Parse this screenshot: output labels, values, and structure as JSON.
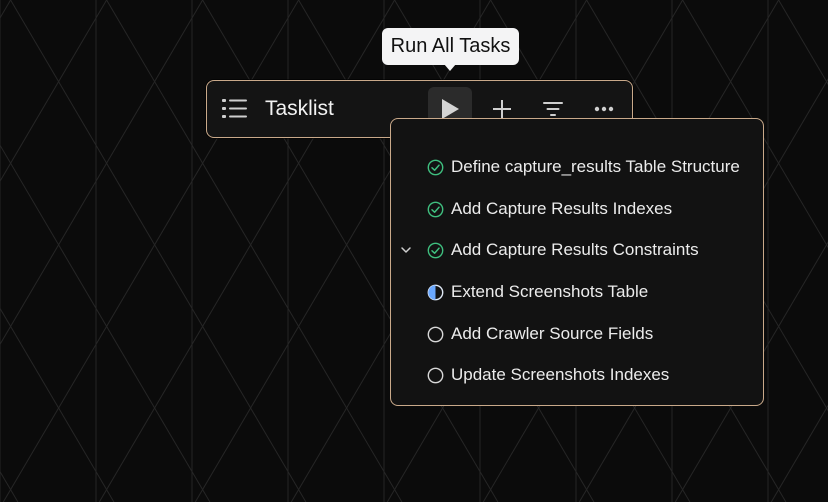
{
  "tooltip": {
    "text": "Run All Tasks"
  },
  "toolbar": {
    "title": "Tasklist",
    "list_icon": "list-icon",
    "buttons": [
      {
        "name": "run-all-button",
        "icon": "play-icon"
      },
      {
        "name": "add-task-button",
        "icon": "plus-icon"
      },
      {
        "name": "filter-button",
        "icon": "filter-icon"
      },
      {
        "name": "more-button",
        "icon": "more-horizontal-icon"
      }
    ]
  },
  "tasks": [
    {
      "label": "Define capture_results Table Structure",
      "status": "completed"
    },
    {
      "label": "Add Capture Results Indexes",
      "status": "completed"
    },
    {
      "label": "Add Capture Results Constraints",
      "status": "completed",
      "expandable": true
    },
    {
      "label": "Extend Screenshots Table",
      "status": "in-progress"
    },
    {
      "label": "Add Crawler Source Fields",
      "status": "pending"
    },
    {
      "label": "Update Screenshots Indexes",
      "status": "pending"
    }
  ],
  "colors": {
    "accent_border": "#c9a98a",
    "completed": "#3fbf7f",
    "in_progress": "#6aa8ff",
    "pending": "#d8d8d8"
  }
}
